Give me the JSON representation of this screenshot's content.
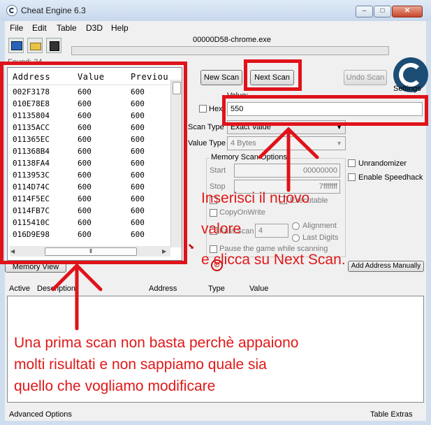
{
  "window": {
    "title": "Cheat Engine 6.3"
  },
  "menu": [
    "File",
    "Edit",
    "Table",
    "D3D",
    "Help"
  ],
  "process_name": "00000D58-chrome.exe",
  "results": {
    "group_label": "Found: 24",
    "columns": [
      "Address",
      "Value",
      "Previou"
    ],
    "rows": [
      {
        "address": "002F3178",
        "value": "600",
        "previous": "600"
      },
      {
        "address": "010E78E8",
        "value": "600",
        "previous": "600"
      },
      {
        "address": "01135804",
        "value": "600",
        "previous": "600"
      },
      {
        "address": "01135ACC",
        "value": "600",
        "previous": "600"
      },
      {
        "address": "011365EC",
        "value": "600",
        "previous": "600"
      },
      {
        "address": "011368B4",
        "value": "600",
        "previous": "600"
      },
      {
        "address": "01138FA4",
        "value": "600",
        "previous": "600"
      },
      {
        "address": "0113953C",
        "value": "600",
        "previous": "600"
      },
      {
        "address": "0114D74C",
        "value": "600",
        "previous": "600"
      },
      {
        "address": "0114F5EC",
        "value": "600",
        "previous": "600"
      },
      {
        "address": "0114FB7C",
        "value": "600",
        "previous": "600"
      },
      {
        "address": "0115410C",
        "value": "600",
        "previous": "600"
      },
      {
        "address": "016D9E98",
        "value": "600",
        "previous": "600"
      }
    ]
  },
  "buttons": {
    "new_scan": "New Scan",
    "next_scan": "Next Scan",
    "undo_scan": "Undo Scan",
    "settings": "Settings",
    "memory_view": "Memory View",
    "add_address": "Add Address Manually"
  },
  "scan": {
    "value_label": "Value:",
    "hex_label": "Hex",
    "value": "550",
    "scan_type_label": "Scan Type",
    "scan_type": "Exact Value",
    "value_type_label": "Value Type",
    "value_type": "4 Bytes",
    "memory_options_label": "Memory Scan Options",
    "start_label": "Start",
    "start_value": "00000000",
    "stop_label": "Stop",
    "stop_value": "7fffffff",
    "copy_on_write": "CopyOnWrite",
    "executable": "Executable",
    "fast_scan": "Fast Scan",
    "fast_scan_value": "4",
    "alignment": "Alignment",
    "last_digits": "Last Digits",
    "pause_game": "Pause the game while scanning",
    "unrandomizer": "Unrandomizer",
    "enable_speedhack": "Enable Speedhack"
  },
  "address_list": {
    "columns": [
      "Active",
      "Description",
      "Address",
      "Type",
      "Value"
    ]
  },
  "status": {
    "left": "Advanced Options",
    "right": "Table Extras"
  },
  "annotations": {
    "right_text": [
      "Inserisci il nuovo",
      "valore",
      "e clicca su Next Scan."
    ],
    "bottom_text": [
      "Una prima scan non basta perchè appaiono",
      "molti risultati e non sappiamo quale sia",
      "quello che vogliamo modificare"
    ]
  },
  "colors": {
    "annotation_red": "#e0121a",
    "title_bar": "#c7d8ec",
    "logo_blue": "#1c4d74"
  }
}
